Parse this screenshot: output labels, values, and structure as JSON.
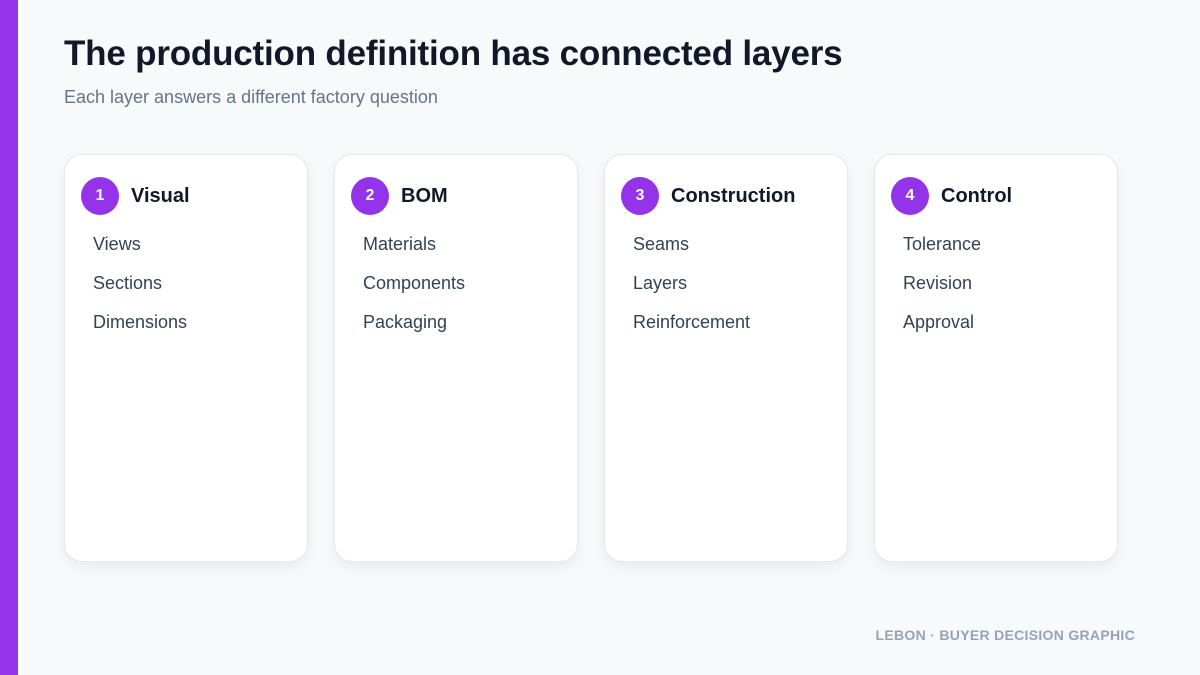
{
  "colors": {
    "accent": "#9333ea",
    "background": "#f8f9fb",
    "card": "#ffffff",
    "title": "#111827",
    "subtitle": "#64748b",
    "footer": "#94a3b8"
  },
  "header": {
    "title": "The production definition has connected layers",
    "subtitle": "Each layer answers a different factory question"
  },
  "cards": [
    {
      "number": "1",
      "title": "Visual",
      "items": [
        "Views",
        "Sections",
        "Dimensions"
      ]
    },
    {
      "number": "2",
      "title": "BOM",
      "items": [
        "Materials",
        "Components",
        "Packaging"
      ]
    },
    {
      "number": "3",
      "title": "Construction",
      "items": [
        "Seams",
        "Layers",
        "Reinforcement"
      ]
    },
    {
      "number": "4",
      "title": "Control",
      "items": [
        "Tolerance",
        "Revision",
        "Approval"
      ]
    }
  ],
  "footer": {
    "text": "LEBON · BUYER DECISION GRAPHIC"
  }
}
